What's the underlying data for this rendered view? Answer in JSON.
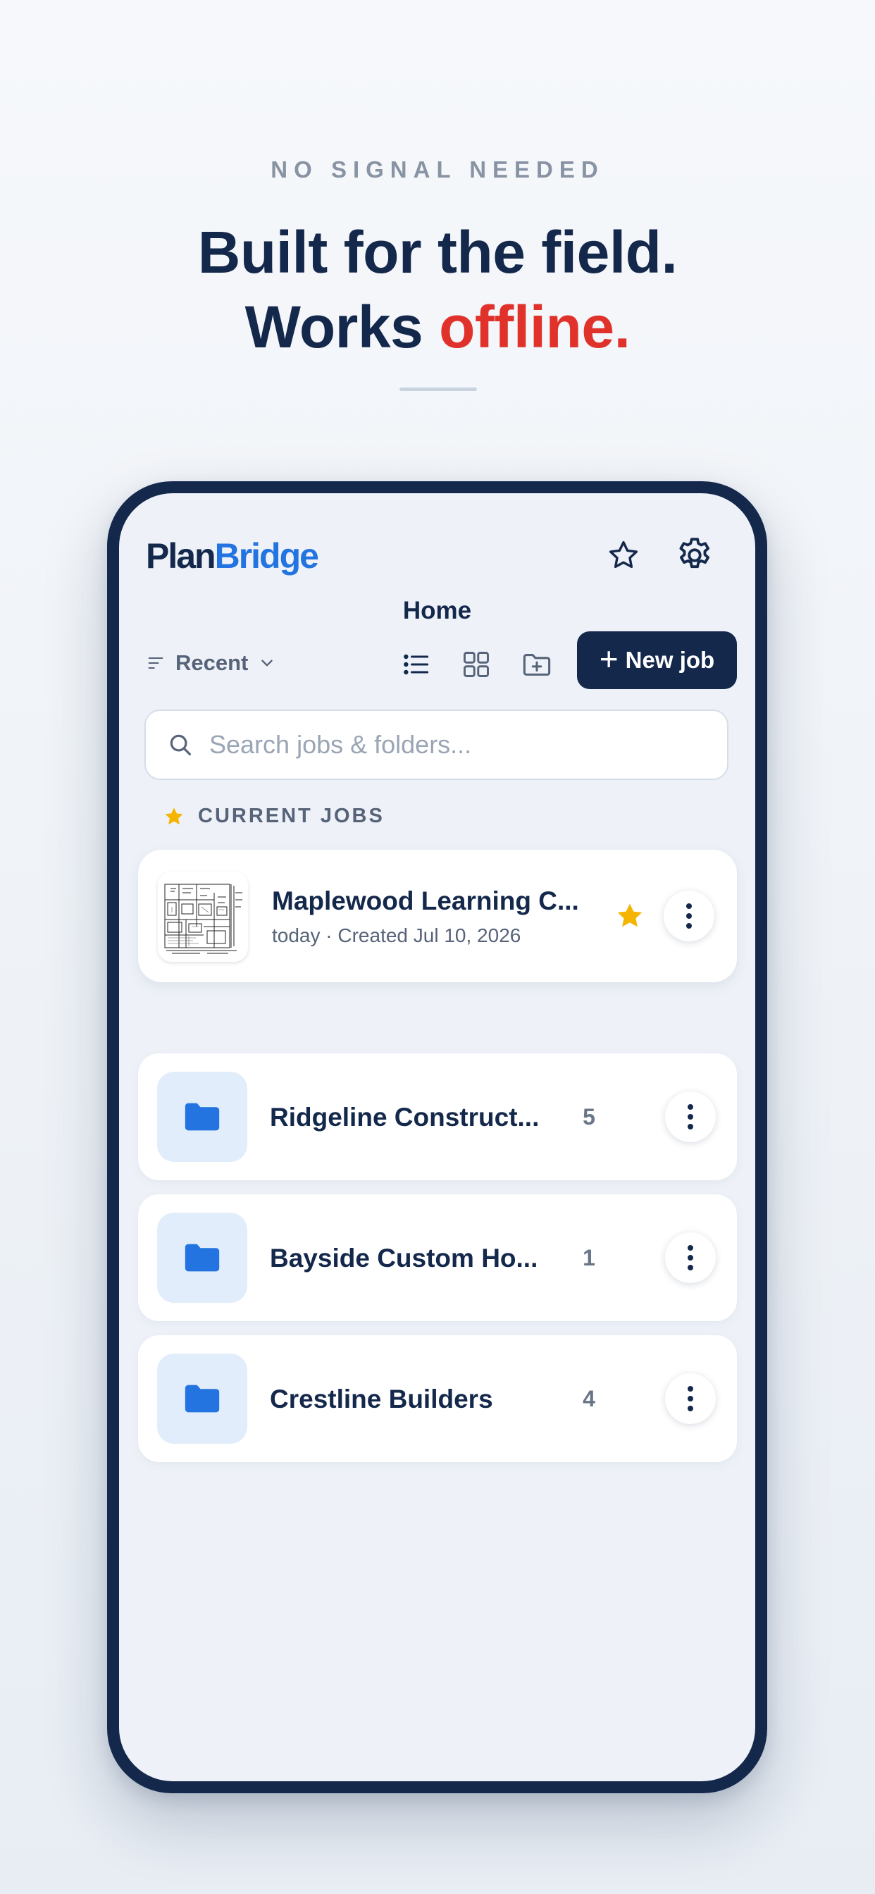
{
  "promo": {
    "eyebrow": "NO SIGNAL NEEDED",
    "headline_line1": "Built for the field.",
    "headline_line2_prefix": "Works ",
    "headline_line2_accent": "offline.",
    "accent_color": "#e0322b"
  },
  "app": {
    "logo_part1": "Plan",
    "logo_part2": "Bridge",
    "brand_color": "#2374e1",
    "page_title": "Home",
    "header_icons": [
      "star-icon",
      "gear-icon"
    ]
  },
  "toolbar": {
    "sort_label": "Recent",
    "view_icons": [
      "list-view-icon",
      "grid-view-icon",
      "add-folder-icon"
    ],
    "new_job_label": "New job"
  },
  "search": {
    "placeholder": "Search jobs & folders...",
    "value": ""
  },
  "current_jobs": {
    "section_label": "CURRENT JOBS",
    "jobs": [
      {
        "name": "Maplewood Learning C...",
        "meta": "today · Created Jul 10, 2026",
        "starred": true
      }
    ]
  },
  "folders": [
    {
      "name": "Ridgeline Construct...",
      "count": "5"
    },
    {
      "name": "Bayside Custom Ho...",
      "count": "1"
    },
    {
      "name": "Crestline Builders",
      "count": "4"
    }
  ],
  "colors": {
    "navy": "#14284b",
    "star_yellow": "#f4b400",
    "folder_blue": "#2374e1"
  }
}
